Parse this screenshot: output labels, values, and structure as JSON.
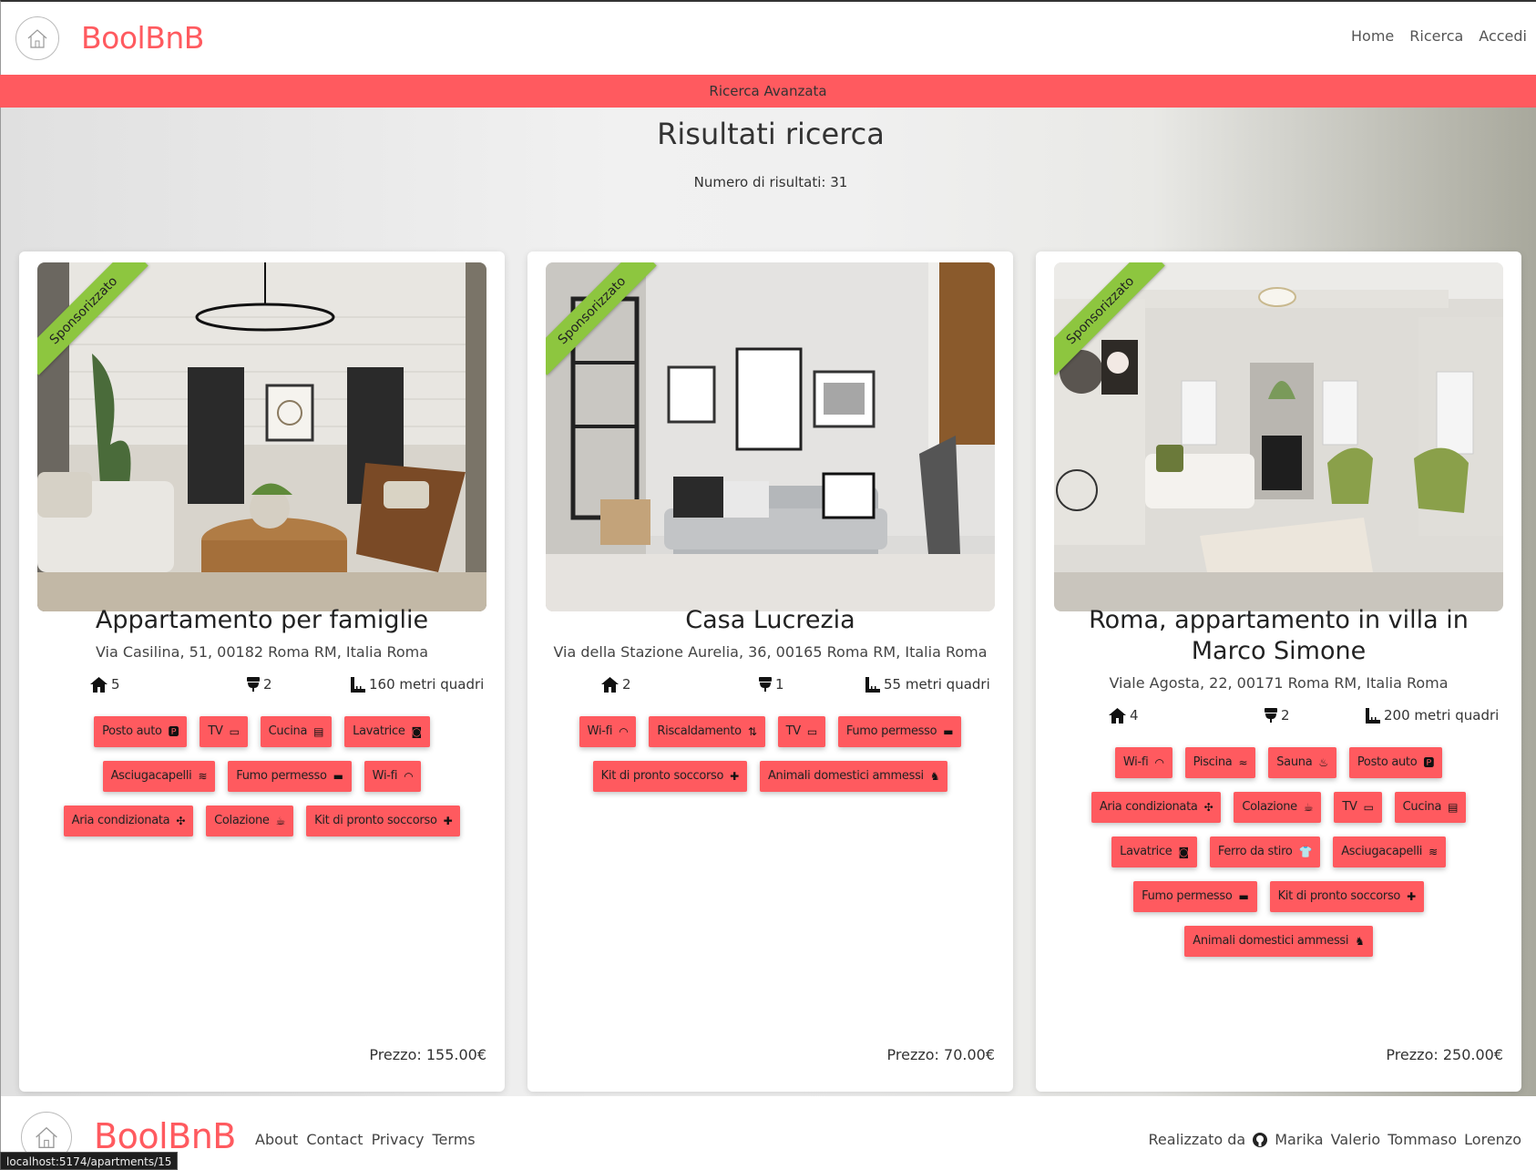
{
  "header": {
    "brand": "BoolBnB",
    "nav": [
      "Home",
      "Ricerca",
      "Accedi"
    ]
  },
  "banner": {
    "label": "Ricerca Avanzata"
  },
  "results": {
    "title": "Risultati ricerca",
    "count_text": "Numero di risultati: 31"
  },
  "cards": [
    {
      "ribbon": "Sponsorizzato",
      "title": "Appartamento per famiglie",
      "address": "Via Casilina, 51, 00182 Roma RM, Italia Roma",
      "rooms": "5",
      "bathrooms": "2",
      "size": "160 metri quadri",
      "services": [
        "Posto auto",
        "TV",
        "Cucina",
        "Lavatrice",
        "Asciugacapelli",
        "Fumo permesso",
        "Wi-fi",
        "Aria condizionata",
        "Colazione",
        "Kit di pronto soccorso"
      ],
      "price": "Prezzo: 155.00€"
    },
    {
      "ribbon": "Sponsorizzato",
      "title": "Casa Lucrezia",
      "address": "Via della Stazione Aurelia, 36, 00165 Roma RM, Italia Roma",
      "rooms": "2",
      "bathrooms": "1",
      "size": "55 metri quadri",
      "services": [
        "Wi-fi",
        "Riscaldamento",
        "TV",
        "Fumo permesso",
        "Kit di pronto soccorso",
        "Animali domestici ammessi"
      ],
      "price": "Prezzo: 70.00€"
    },
    {
      "ribbon": "Sponsorizzato",
      "title": "Roma, appartamento in villa in Marco Simone",
      "address": "Viale Agosta, 22, 00171 Roma RM, Italia Roma",
      "rooms": "4",
      "bathrooms": "2",
      "size": "200 metri quadri",
      "services": [
        "Wi-fi",
        "Piscina",
        "Sauna",
        "Posto auto",
        "Aria condizionata",
        "Colazione",
        "TV",
        "Cucina",
        "Lavatrice",
        "Ferro da stiro",
        "Asciugacapelli",
        "Fumo permesso",
        "Kit di pronto soccorso",
        "Animali domestici ammessi"
      ],
      "price": "Prezzo: 250.00€"
    }
  ],
  "footer": {
    "brand": "BoolBnB",
    "links": [
      "About",
      "Contact",
      "Privacy",
      "Terms"
    ],
    "credits_label": "Realizzato da",
    "authors": [
      "Marika",
      "Valerio",
      "Tommaso",
      "Lorenzo"
    ]
  },
  "status_url": "localhost:5174/apartments/15",
  "colors": {
    "brand": "#ff5a5f",
    "ribbon": "#8dc63f"
  }
}
